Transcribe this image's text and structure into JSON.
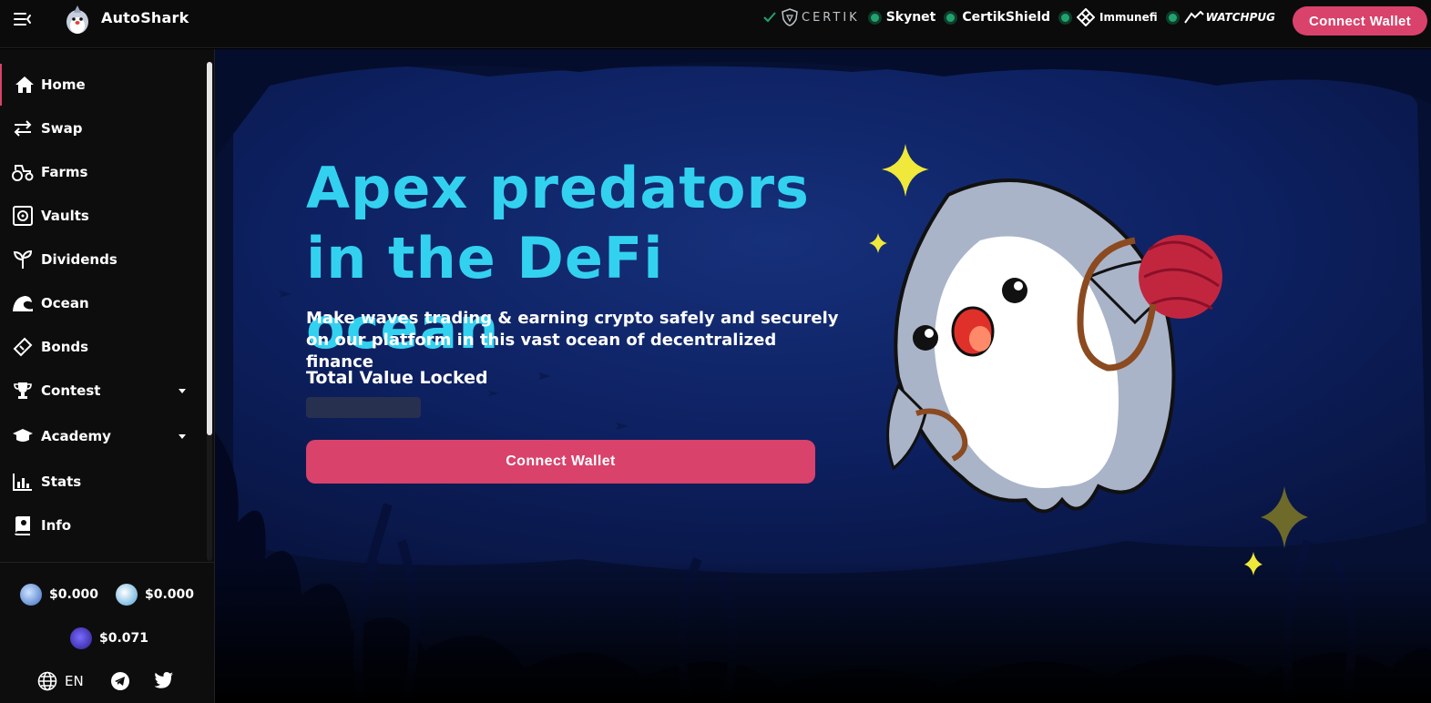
{
  "app": {
    "name": "AutoShark"
  },
  "header": {
    "audits": [
      {
        "label": "CERTIK",
        "style": "certik"
      },
      {
        "label": "Skynet"
      },
      {
        "label": "CertikShield"
      },
      {
        "label": "Immunefi"
      },
      {
        "label": "WATCHPUG"
      }
    ],
    "connect_label": "Connect Wallet"
  },
  "sidebar": {
    "items": [
      {
        "label": "Home",
        "icon": "home-icon",
        "active": true
      },
      {
        "label": "Swap",
        "icon": "swap-icon"
      },
      {
        "label": "Farms",
        "icon": "tractor-icon"
      },
      {
        "label": "Vaults",
        "icon": "vault-icon"
      },
      {
        "label": "Dividends",
        "icon": "sprout-icon"
      },
      {
        "label": "Ocean",
        "icon": "wave-icon"
      },
      {
        "label": "Bonds",
        "icon": "ticket-icon"
      },
      {
        "label": "Contest",
        "icon": "trophy-icon",
        "has_dropdown": true
      },
      {
        "label": "Academy",
        "icon": "graduation-cap-icon",
        "has_dropdown": true
      },
      {
        "label": "Stats",
        "icon": "bar-chart-icon"
      },
      {
        "label": "Info",
        "icon": "info-book-icon"
      }
    ],
    "prices": [
      {
        "value": "$0.000",
        "icon": "jaws-coin-icon"
      },
      {
        "value": "$0.000",
        "icon": "finn-coin-icon"
      },
      {
        "value": "$0.071",
        "icon": "shark-coin-icon"
      }
    ],
    "language": "EN"
  },
  "hero": {
    "headline": "Apex predators in the DeFi ocean",
    "subtext": "Make waves trading & earning crypto safely and securely on our platform in this vast ocean of decentralized finance",
    "tvl_label": "Total Value Locked",
    "connect_label": "Connect Wallet"
  },
  "colors": {
    "accent": "#d8426b",
    "headline": "#33d1f0",
    "ocean": "#0b1a4a",
    "status_green": "#21a36f"
  }
}
